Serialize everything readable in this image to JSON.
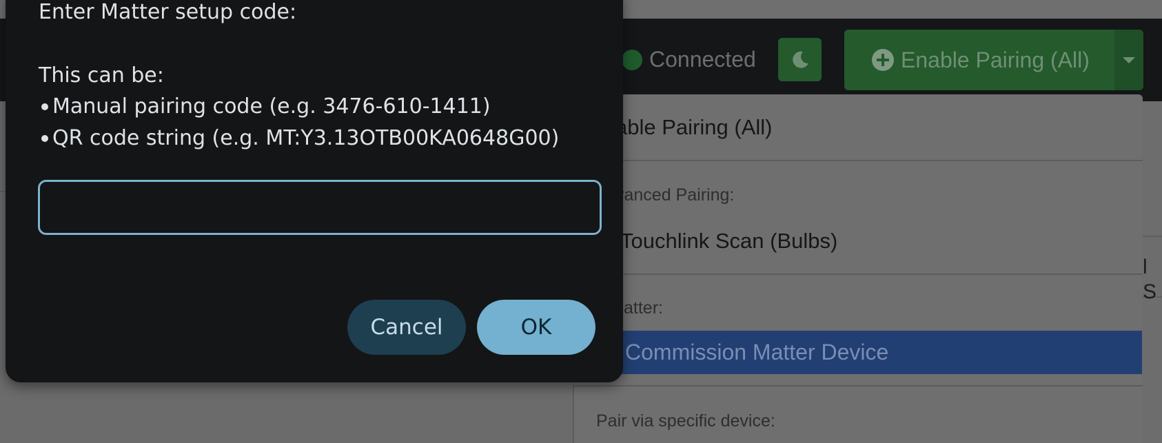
{
  "navbar": {
    "status_text": "Connected",
    "theme_toggle_icon": "moon-icon",
    "pair_button_label": "Enable Pairing (All)",
    "pair_button_icon": "plus-circle-icon",
    "pair_caret_icon": "caret-down-icon"
  },
  "dropdown": {
    "enable_all_label": "able Pairing (All)",
    "advanced_header": "vanced Pairing:",
    "touchlink_label": "Touchlink Scan (Bulbs)",
    "matter_header": "atter:",
    "commission_label": "Commission Matter Device",
    "specific_header": "Pair via specific device:"
  },
  "background": {
    "partial_text": "l S"
  },
  "dialog": {
    "prompt": "Enter Matter setup code:",
    "can_be": "This can be:",
    "option_manual": "Manual pairing code (e.g. 3476-610-1411)",
    "option_qr": "QR code string (e.g. MT:Y3.13OTB00KA0648G00)",
    "input_value": "",
    "cancel_label": "Cancel",
    "ok_label": "OK"
  },
  "colors": {
    "dialog_bg": "#131517",
    "input_border": "#7fb1cf",
    "ok_bg": "#74b0cf",
    "cancel_bg": "#1e3f50",
    "active_item_bg": "#223f73"
  }
}
